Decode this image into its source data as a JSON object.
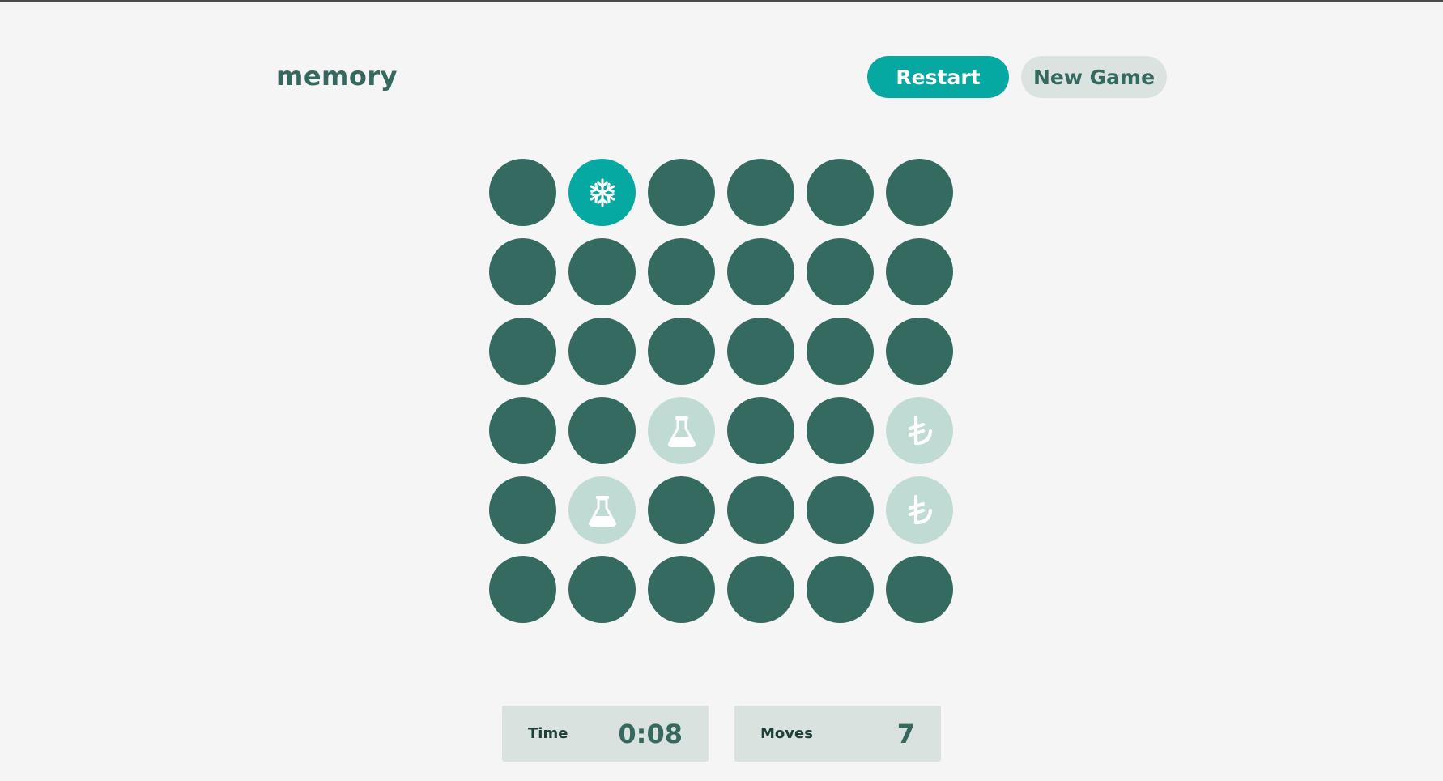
{
  "header": {
    "logo": "memory",
    "restart_label": "Restart",
    "new_game_label": "New Game"
  },
  "board": {
    "rows": 6,
    "cols": 6,
    "tiles": [
      {
        "row": 0,
        "col": 0,
        "state": "hidden",
        "icon": null
      },
      {
        "row": 0,
        "col": 1,
        "state": "revealed",
        "icon": "snowflake-icon"
      },
      {
        "row": 0,
        "col": 2,
        "state": "hidden",
        "icon": null
      },
      {
        "row": 0,
        "col": 3,
        "state": "hidden",
        "icon": null
      },
      {
        "row": 0,
        "col": 4,
        "state": "hidden",
        "icon": null
      },
      {
        "row": 0,
        "col": 5,
        "state": "hidden",
        "icon": null
      },
      {
        "row": 1,
        "col": 0,
        "state": "hidden",
        "icon": null
      },
      {
        "row": 1,
        "col": 1,
        "state": "hidden",
        "icon": null
      },
      {
        "row": 1,
        "col": 2,
        "state": "hidden",
        "icon": null
      },
      {
        "row": 1,
        "col": 3,
        "state": "hidden",
        "icon": null
      },
      {
        "row": 1,
        "col": 4,
        "state": "hidden",
        "icon": null
      },
      {
        "row": 1,
        "col": 5,
        "state": "hidden",
        "icon": null
      },
      {
        "row": 2,
        "col": 0,
        "state": "hidden",
        "icon": null
      },
      {
        "row": 2,
        "col": 1,
        "state": "hidden",
        "icon": null
      },
      {
        "row": 2,
        "col": 2,
        "state": "hidden",
        "icon": null
      },
      {
        "row": 2,
        "col": 3,
        "state": "hidden",
        "icon": null
      },
      {
        "row": 2,
        "col": 4,
        "state": "hidden",
        "icon": null
      },
      {
        "row": 2,
        "col": 5,
        "state": "hidden",
        "icon": null
      },
      {
        "row": 3,
        "col": 0,
        "state": "hidden",
        "icon": null
      },
      {
        "row": 3,
        "col": 1,
        "state": "hidden",
        "icon": null
      },
      {
        "row": 3,
        "col": 2,
        "state": "matched",
        "icon": "flask-icon"
      },
      {
        "row": 3,
        "col": 3,
        "state": "hidden",
        "icon": null
      },
      {
        "row": 3,
        "col": 4,
        "state": "hidden",
        "icon": null
      },
      {
        "row": 3,
        "col": 5,
        "state": "matched",
        "icon": "lira-sign-icon"
      },
      {
        "row": 4,
        "col": 0,
        "state": "hidden",
        "icon": null
      },
      {
        "row": 4,
        "col": 1,
        "state": "matched",
        "icon": "flask-icon"
      },
      {
        "row": 4,
        "col": 2,
        "state": "hidden",
        "icon": null
      },
      {
        "row": 4,
        "col": 3,
        "state": "hidden",
        "icon": null
      },
      {
        "row": 4,
        "col": 4,
        "state": "hidden",
        "icon": null
      },
      {
        "row": 4,
        "col": 5,
        "state": "matched",
        "icon": "lira-sign-icon"
      },
      {
        "row": 5,
        "col": 0,
        "state": "hidden",
        "icon": null
      },
      {
        "row": 5,
        "col": 1,
        "state": "hidden",
        "icon": null
      },
      {
        "row": 5,
        "col": 2,
        "state": "hidden",
        "icon": null
      },
      {
        "row": 5,
        "col": 3,
        "state": "hidden",
        "icon": null
      },
      {
        "row": 5,
        "col": 4,
        "state": "hidden",
        "icon": null
      },
      {
        "row": 5,
        "col": 5,
        "state": "hidden",
        "icon": null
      }
    ]
  },
  "stats": {
    "time_label": "Time",
    "time_value": "0:08",
    "moves_label": "Moves",
    "moves_value": "7"
  },
  "colors": {
    "background": "#f5f5f5",
    "primary": "#35685f",
    "accent": "#06a8a2",
    "matched": "#bfdbd4",
    "stat_bg": "#dae2df"
  }
}
